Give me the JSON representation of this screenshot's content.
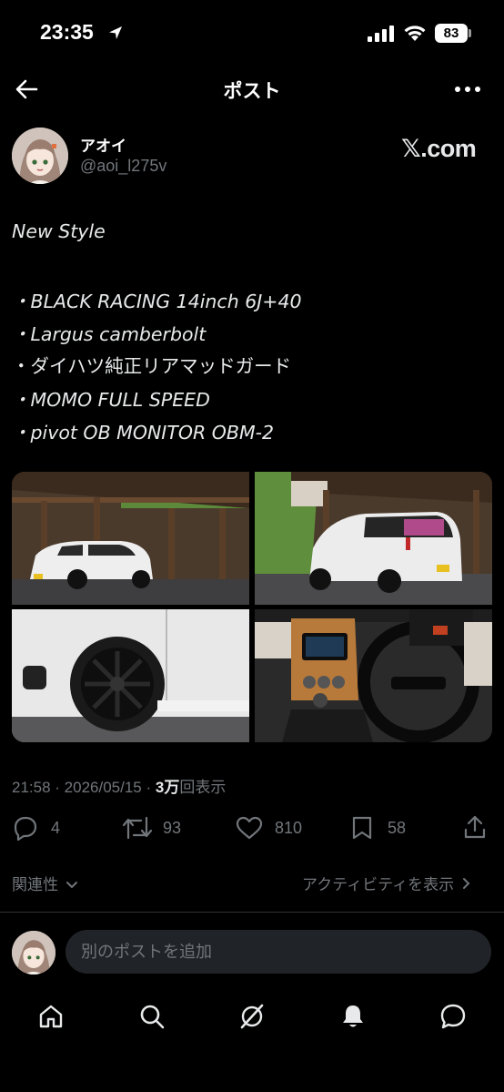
{
  "status_bar": {
    "time": "23:35",
    "battery": "83"
  },
  "header": {
    "title": "ポスト"
  },
  "author": {
    "name": "アオイ",
    "handle": "@aoi_l275v",
    "source_badge": "𝕏.com"
  },
  "post": {
    "lines": [
      "New Style",
      "・BLACK RACING 14inch 6J+40",
      "・Largus camberbolt",
      "・ダイハツ純正リアマッドガード",
      "・MOMO FULL SPEED",
      "・pivot OB MONITOR OBM-2"
    ],
    "images": [
      "white car under wooden shelter, front",
      "white car under wooden shelter, rear",
      "black wheel close-up",
      "car interior with MOMO steering wheel"
    ]
  },
  "meta": {
    "time": "21:58",
    "date": "2026/05/15",
    "views_count": "3万",
    "views_label": "回表示"
  },
  "stats": {
    "replies": "4",
    "reposts": "93",
    "likes": "810",
    "bookmarks": "58"
  },
  "sort": {
    "relevance_label": "関連性",
    "activity_label": "アクティビティを表示"
  },
  "reply": {
    "placeholder": "別のポストを追加"
  },
  "nav": [
    "home-icon",
    "search-icon",
    "grok-icon",
    "notifications-icon",
    "messages-icon"
  ]
}
